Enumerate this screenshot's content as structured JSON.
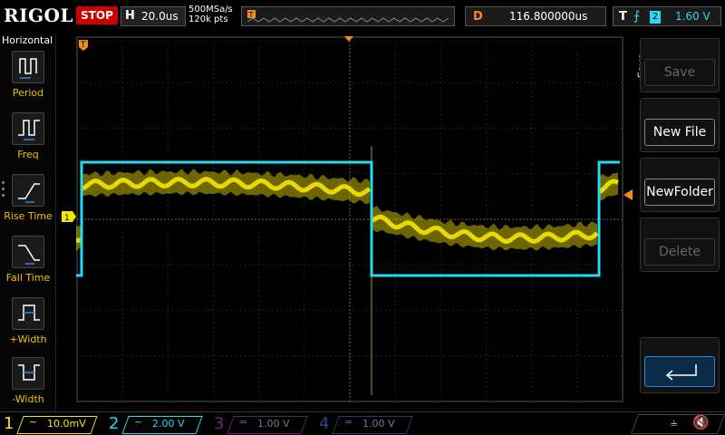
{
  "top_bar": {
    "brand": "RIGOL",
    "run_state": "STOP",
    "horizontal_key": "H",
    "time_base": "20.0us",
    "sample_rate": "500MSa/s",
    "memory_depth": "120k pts",
    "delay_key": "D",
    "delay_value": "116.800000us",
    "trigger_key": "T",
    "trigger_channel": "2",
    "trigger_level": "1.60 V"
  },
  "left_menu": {
    "title": "Horizontal",
    "items": [
      {
        "label": "Period",
        "icon": "period-icon"
      },
      {
        "label": "Freq",
        "icon": "freq-icon"
      },
      {
        "label": "Rise Time",
        "icon": "rise-time-icon"
      },
      {
        "label": "Fall Time",
        "icon": "fall-time-icon"
      },
      {
        "label": "+Width",
        "icon": "positive-width-icon"
      },
      {
        "label": "-Width",
        "icon": "negative-width-icon"
      }
    ]
  },
  "right_menu": {
    "tab_label": "Save",
    "buttons": [
      {
        "label": "Save",
        "enabled": false
      },
      {
        "label": "New File",
        "enabled": true
      },
      {
        "label": "NewFolder",
        "enabled": true
      },
      {
        "label": "Delete",
        "enabled": false
      }
    ],
    "enter_icon": "enter-return-icon"
  },
  "channels": [
    {
      "num": "1",
      "coupling": "~",
      "scale": "10.0mV",
      "color": "#f5e600",
      "active": true
    },
    {
      "num": "2",
      "coupling": "~",
      "scale": "2.00 V",
      "color": "#29d9f0",
      "active": true
    },
    {
      "num": "3",
      "coupling": "=",
      "scale": "1.00 V",
      "color": "#c03acb",
      "active": false
    },
    {
      "num": "4",
      "coupling": "=",
      "scale": "1.00 V",
      "color": "#2f6be6",
      "active": false
    }
  ],
  "scope": {
    "ch1_marker": "1",
    "trigger_marker": "T",
    "colors": {
      "ch1": "#f5e600",
      "ch2": "#29d9f0",
      "trigger": "#f28c1c",
      "grid": "#3a3a3a"
    }
  },
  "status_icons": [
    "usb-icon",
    "sound-mute-icon"
  ]
}
